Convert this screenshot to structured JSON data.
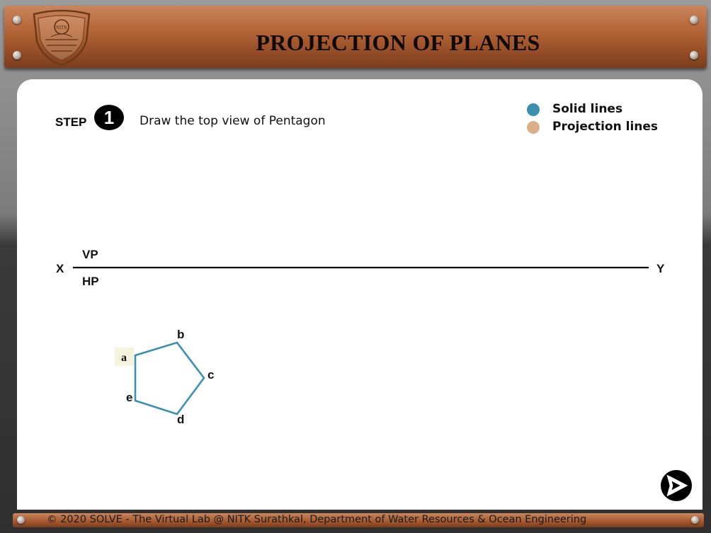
{
  "header": {
    "title": "PROJECTION OF PLANES",
    "logo_text": "NITK",
    "brand_color": "#a4572d"
  },
  "step": {
    "label": "STEP",
    "number": "1",
    "instruction": "Draw the top view of Pentagon"
  },
  "legend": [
    {
      "label": "Solid lines",
      "color": "#3b90b0"
    },
    {
      "label": "Projection lines",
      "color": "#d9b089"
    }
  ],
  "reference_line": {
    "left_label": "X",
    "right_label": "Y",
    "above_label": "VP",
    "below_label": "HP"
  },
  "pentagon": {
    "vertex_labels": [
      "a",
      "b",
      "c",
      "d",
      "e"
    ],
    "line_color": "#3b90b0"
  },
  "navigation": {
    "next_icon": "right-arrow-icon"
  },
  "footer": {
    "text": "© 2020 SOLVE - The Virtual Lab @ NITK Surathkal, Department of Water Resources & Ocean Engineering"
  }
}
